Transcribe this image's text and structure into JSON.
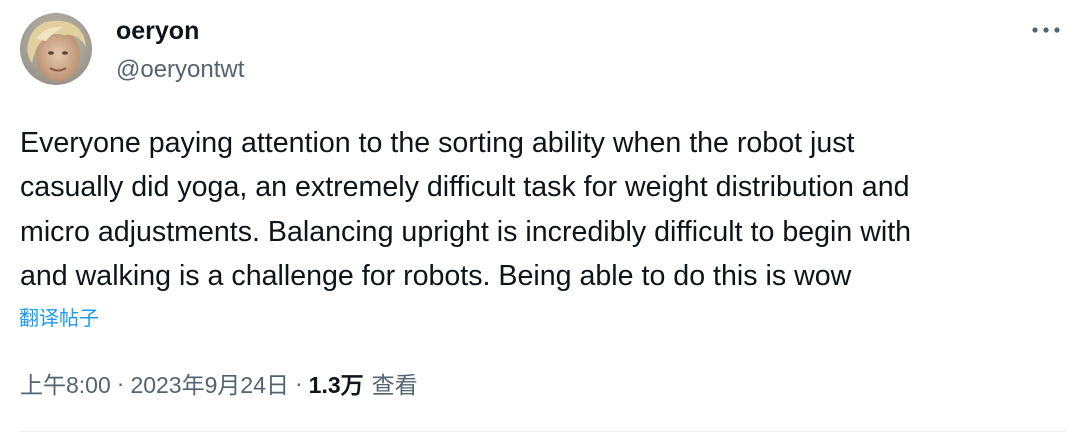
{
  "user": {
    "display_name": "oeryon",
    "handle": "@oeryontwt",
    "avatar_icon": "profile-photo"
  },
  "tweet": {
    "text": "Everyone paying attention to the sorting ability when the robot just\ncasually did yoga, an extremely difficult task for weight distribution and\nmicro adjustments. Balancing upright is incredibly difficult to begin with\nand walking is a challenge for robots. Being able to do this is wow",
    "translate_label": "翻译帖子"
  },
  "meta": {
    "time": "上午8:00",
    "separator": "·",
    "date": "2023年9月24日",
    "views_count": "1.3万",
    "views_label": "查看"
  },
  "colors": {
    "text_primary": "#0f1419",
    "text_secondary": "#536471",
    "link": "#1d9bf0"
  },
  "icons": {
    "more": "more-horizontal-icon"
  }
}
